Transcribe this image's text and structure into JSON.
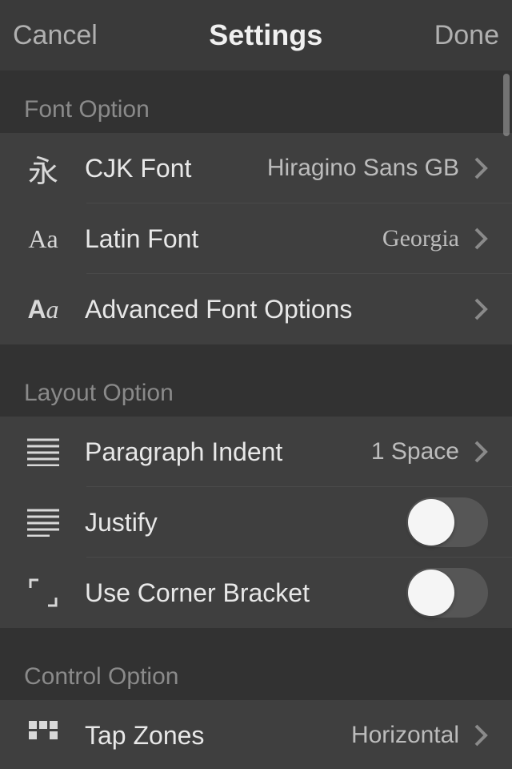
{
  "header": {
    "cancel": "Cancel",
    "title": "Settings",
    "done": "Done"
  },
  "sections": {
    "font": {
      "title": "Font Option",
      "cjk": {
        "label": "CJK Font",
        "value": "Hiragino Sans GB"
      },
      "latin": {
        "label": "Latin Font",
        "value": "Georgia"
      },
      "advanced": {
        "label": "Advanced Font Options"
      }
    },
    "layout": {
      "title": "Layout Option",
      "indent": {
        "label": "Paragraph Indent",
        "value": "1 Space"
      },
      "justify": {
        "label": "Justify",
        "on": false
      },
      "corner": {
        "label": "Use Corner Bracket",
        "on": false
      }
    },
    "control": {
      "title": "Control Option",
      "tapzones": {
        "label": "Tap Zones",
        "value": "Horizontal"
      }
    }
  }
}
